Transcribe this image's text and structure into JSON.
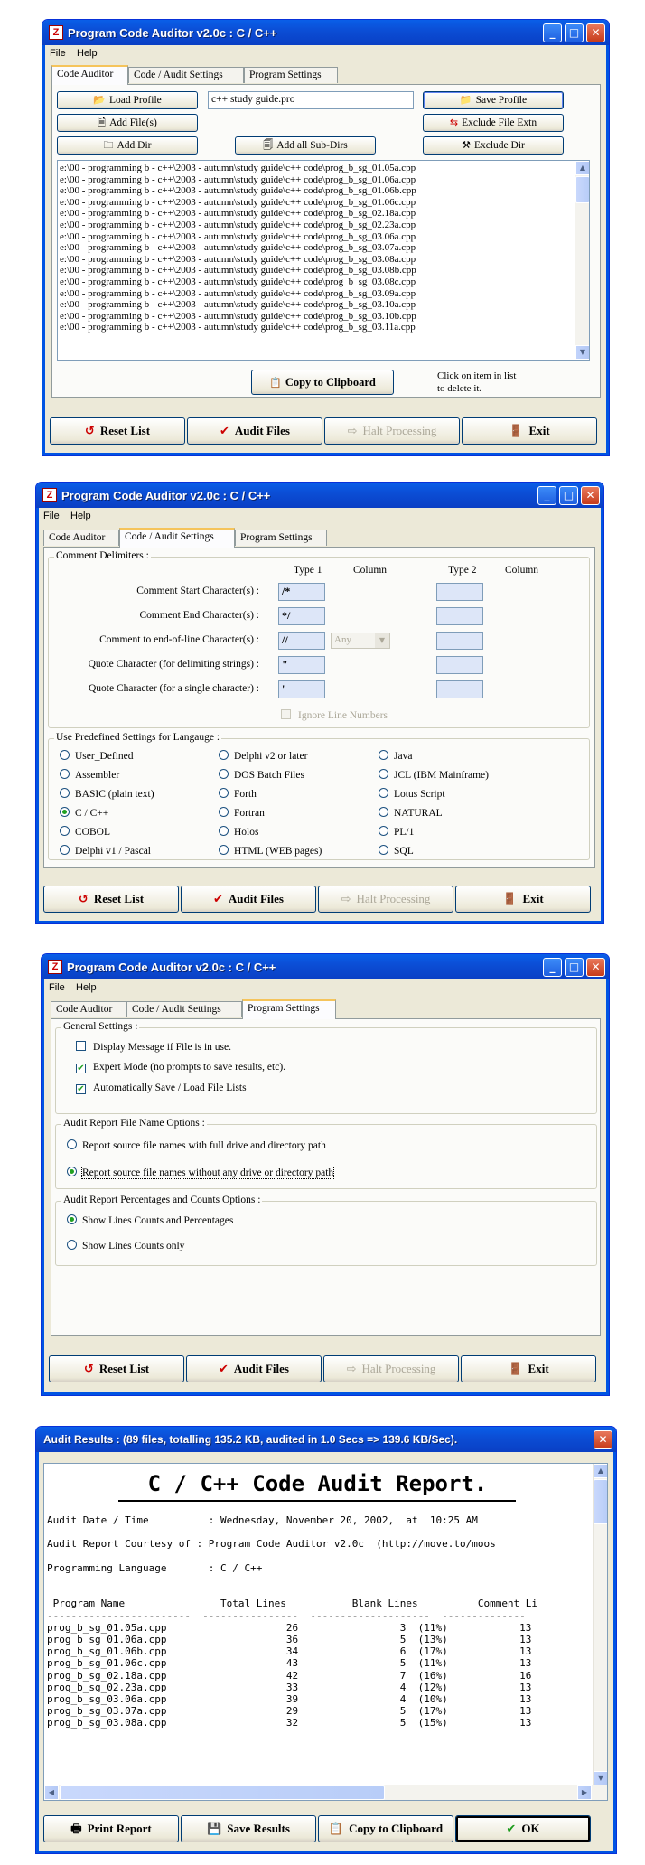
{
  "app_title": "Program Code Auditor v2.0c  :  C / C++",
  "menu": {
    "file": "File",
    "help": "Help"
  },
  "tabs": [
    "Code Auditor",
    "Code / Audit Settings",
    "Program Settings"
  ],
  "bottom_buttons": {
    "reset": "Reset List",
    "audit": "Audit Files",
    "halt": "Halt Processing",
    "exit": "Exit"
  },
  "win1": {
    "load_profile": "Load Profile",
    "profile_name": "c++ study guide.pro",
    "save_profile": "Save Profile",
    "add_files": "Add File(s)",
    "exclude_ext": "Exclude File Extn",
    "add_dir": "Add Dir",
    "add_subdirs": "Add all Sub-Dirs",
    "exclude_dir": "Exclude Dir",
    "files": [
      "e:\\00 - programming b - c++\\2003 - autumn\\study guide\\c++ code\\prog_b_sg_01.05a.cpp",
      "e:\\00 - programming b - c++\\2003 - autumn\\study guide\\c++ code\\prog_b_sg_01.06a.cpp",
      "e:\\00 - programming b - c++\\2003 - autumn\\study guide\\c++ code\\prog_b_sg_01.06b.cpp",
      "e:\\00 - programming b - c++\\2003 - autumn\\study guide\\c++ code\\prog_b_sg_01.06c.cpp",
      "e:\\00 - programming b - c++\\2003 - autumn\\study guide\\c++ code\\prog_b_sg_02.18a.cpp",
      "e:\\00 - programming b - c++\\2003 - autumn\\study guide\\c++ code\\prog_b_sg_02.23a.cpp",
      "e:\\00 - programming b - c++\\2003 - autumn\\study guide\\c++ code\\prog_b_sg_03.06a.cpp",
      "e:\\00 - programming b - c++\\2003 - autumn\\study guide\\c++ code\\prog_b_sg_03.07a.cpp",
      "e:\\00 - programming b - c++\\2003 - autumn\\study guide\\c++ code\\prog_b_sg_03.08a.cpp",
      "e:\\00 - programming b - c++\\2003 - autumn\\study guide\\c++ code\\prog_b_sg_03.08b.cpp",
      "e:\\00 - programming b - c++\\2003 - autumn\\study guide\\c++ code\\prog_b_sg_03.08c.cpp",
      "e:\\00 - programming b - c++\\2003 - autumn\\study guide\\c++ code\\prog_b_sg_03.09a.cpp",
      "e:\\00 - programming b - c++\\2003 - autumn\\study guide\\c++ code\\prog_b_sg_03.10a.cpp",
      "e:\\00 - programming b - c++\\2003 - autumn\\study guide\\c++ code\\prog_b_sg_03.10b.cpp",
      "e:\\00 - programming b - c++\\2003 - autumn\\study guide\\c++ code\\prog_b_sg_03.11a.cpp"
    ],
    "copy_clipboard": "Copy to Clipboard",
    "hint_line1": "Click on item in list",
    "hint_line2": "to delete it."
  },
  "win2": {
    "group_comment": "Comment Delimiters :",
    "col_type1": "Type 1",
    "col_column": "Column",
    "col_type2": "Type 2",
    "col_column2": "Column",
    "rows": [
      {
        "label": "Comment Start Character(s) :",
        "type1": "/*",
        "type2": ""
      },
      {
        "label": "Comment End Character(s) :",
        "type1": "*/",
        "type2": ""
      },
      {
        "label": "Comment to end-of-line Character(s) :",
        "type1": "//",
        "type2": ""
      },
      {
        "label": "Quote Character (for delimiting strings) :",
        "type1": "\"",
        "type2": ""
      },
      {
        "label": "Quote Character (for a single character) :",
        "type1": "'",
        "type2": ""
      }
    ],
    "column_combo": "Any",
    "ignore_line_numbers": "Ignore Line Numbers",
    "group_lang": "Use Predefined Settings for Langauge :",
    "languages": [
      [
        "User_Defined",
        "Delphi v2 or later",
        "Java"
      ],
      [
        "Assembler",
        "DOS Batch Files",
        "JCL (IBM Mainframe)"
      ],
      [
        "BASIC (plain text)",
        "Forth",
        "Lotus Script"
      ],
      [
        "C / C++",
        "Fortran",
        "NATURAL"
      ],
      [
        "COBOL",
        "Holos",
        "PL/1"
      ],
      [
        "Delphi v1 / Pascal",
        "HTML (WEB pages)",
        "SQL"
      ]
    ],
    "selected_language": "C / C++"
  },
  "win3": {
    "group_general": "General Settings :",
    "opt_display": "Display Message if File is in use.",
    "opt_expert": "Expert Mode (no prompts to save results, etc).",
    "opt_autosave": "Automatically Save / Load File Lists",
    "checked": [
      false,
      true,
      true
    ],
    "group_filename": "Audit Report File Name Options :",
    "opt_full_path": "Report source file names with full drive and directory path",
    "opt_no_path": "Report source file names without any drive or directory path",
    "group_pct": "Audit Report Percentages and Counts Options :",
    "opt_show_pct": "Show Lines Counts and Percentages",
    "opt_show_counts": "Show Lines Counts only"
  },
  "win4": {
    "title": "Audit Results :   (89 files, totalling 135.2 KB, audited in 1.0 Secs => 139.6 KB/Sec).",
    "report_title": "C / C++ Code Audit Report.",
    "lines": [
      "Audit Date / Time          : Wednesday, November 20, 2002,  at  10:25 AM",
      "",
      "Audit Report Courtesy of : Program Code Auditor v2.0c  (http://move.to/moos",
      "",
      "Programming Language       : C / C++",
      "",
      "",
      " Program Name                Total Lines           Blank Lines          Comment Li",
      "------------------------  ----------------  --------------------  --------------",
      "prog_b_sg_01.05a.cpp                    26                 3  (11%)            13",
      "prog_b_sg_01.06a.cpp                    36                 5  (13%)            13",
      "prog_b_sg_01.06b.cpp                    34                 6  (17%)            13",
      "prog_b_sg_01.06c.cpp                    43                 5  (11%)            13",
      "prog_b_sg_02.18a.cpp                    42                 7  (16%)            16",
      "prog_b_sg_02.23a.cpp                    33                 4  (12%)            13",
      "prog_b_sg_03.06a.cpp                    39                 4  (10%)            13",
      "prog_b_sg_03.07a.cpp                    29                 5  (17%)            13",
      "prog_b_sg_03.08a.cpp                    32                 5  (15%)            13"
    ],
    "print_report": "Print Report",
    "save_results": "Save Results",
    "copy_clipboard": "Copy to Clipboard",
    "ok": "OK"
  }
}
